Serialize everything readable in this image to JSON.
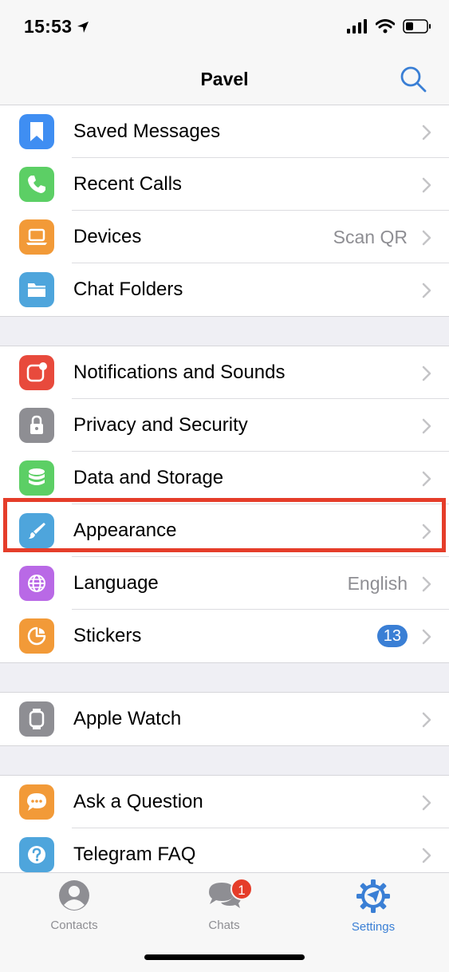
{
  "status_bar": {
    "time": "15:53"
  },
  "nav": {
    "title": "Pavel"
  },
  "groups": [
    [
      {
        "label": "Saved Messages",
        "icon": "bookmark-icon",
        "color": "#3f8ef2"
      },
      {
        "label": "Recent Calls",
        "icon": "phone-icon",
        "color": "#5ccf65"
      },
      {
        "label": "Devices",
        "icon": "laptop-icon",
        "color": "#f29a38",
        "value": "Scan QR"
      },
      {
        "label": "Chat Folders",
        "icon": "folder-icon",
        "color": "#4ea5dc"
      }
    ],
    [
      {
        "label": "Notifications and Sounds",
        "icon": "notification-icon",
        "color": "#e84a3c"
      },
      {
        "label": "Privacy and Security",
        "icon": "lock-icon",
        "color": "#8e8e93"
      },
      {
        "label": "Data and Storage",
        "icon": "database-icon",
        "color": "#5ccf65"
      },
      {
        "label": "Appearance",
        "icon": "brush-icon",
        "color": "#4ea5dc"
      },
      {
        "label": "Language",
        "icon": "globe-icon",
        "color": "#b969e6",
        "value": "English"
      },
      {
        "label": "Stickers",
        "icon": "sticker-icon",
        "color": "#f29a38",
        "badge": "13"
      }
    ],
    [
      {
        "label": "Apple Watch",
        "icon": "watch-icon",
        "color": "#8e8e93"
      }
    ],
    [
      {
        "label": "Ask a Question",
        "icon": "chat-bubble-icon",
        "color": "#f29a38"
      },
      {
        "label": "Telegram FAQ",
        "icon": "question-icon",
        "color": "#4ea5dc"
      }
    ]
  ],
  "tabbar": {
    "contacts": "Contacts",
    "chats": "Chats",
    "chats_badge": "1",
    "settings": "Settings"
  },
  "colors": {
    "accent": "#3a7fd5",
    "highlight": "#e53d2a"
  }
}
